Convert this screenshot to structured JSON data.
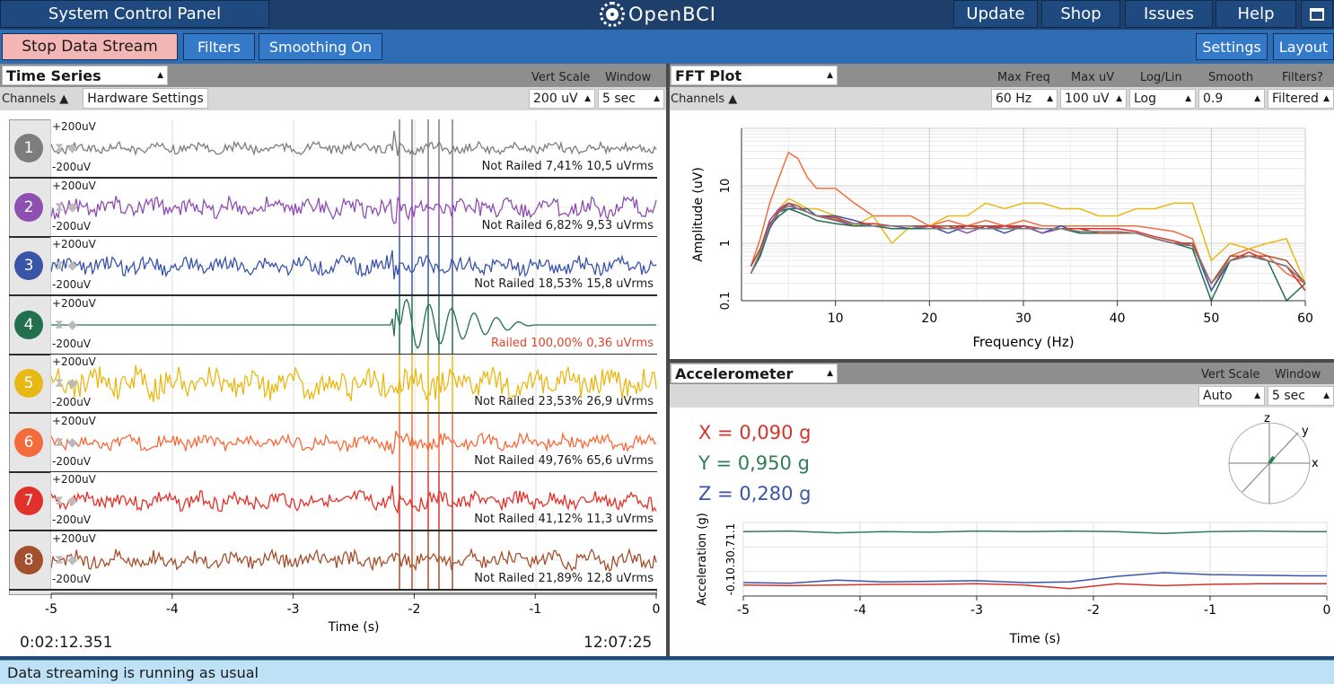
{
  "topbar": {
    "title": "System Control Panel",
    "logo": "OpenBCI",
    "update": "Update",
    "shop": "Shop",
    "issues": "Issues",
    "help": "Help"
  },
  "toolbar": {
    "stop": "Stop Data Stream",
    "filters": "Filters",
    "smoothing": "Smoothing On",
    "settings": "Settings",
    "layout": "Layout"
  },
  "timeseries": {
    "title": "Time Series",
    "vert_scale_label": "Vert Scale",
    "window_label": "Window",
    "channels_label": "Channels",
    "hardware": "Hardware Settings",
    "vert_scale": "200 uV",
    "window": "5 sec",
    "top_label": "+200uV",
    "bottom_label": "-200uV",
    "xlabel": "Time (s)",
    "xticks": [
      "-5",
      "-4",
      "-3",
      "-2",
      "-1",
      "0"
    ],
    "elapsed": "0:02:12.351",
    "clock": "12:07:25",
    "channels": [
      {
        "num": "1",
        "color": "#7d7d7d",
        "status": "Not Railed 7,41% 10,5 uVrms"
      },
      {
        "num": "2",
        "color": "#8d4fb0",
        "status": "Not Railed 6,82% 9,53 uVrms"
      },
      {
        "num": "3",
        "color": "#3a55a6",
        "status": "Not Railed 18,53% 15,8 uVrms"
      },
      {
        "num": "4",
        "color": "#23704e",
        "status": "Railed 100,00% 0,36 uVrms",
        "status_color": "#e0442c"
      },
      {
        "num": "5",
        "color": "#e8b915",
        "status": "Not Railed 23,53% 26,9 uVrms"
      },
      {
        "num": "6",
        "color": "#f26c3c",
        "status": "Not Railed 49,76% 65,6 uVrms"
      },
      {
        "num": "7",
        "color": "#e0322a",
        "status": "Not Railed 41,12% 11,3 uVrms"
      },
      {
        "num": "8",
        "color": "#a4502e",
        "status": "Not Railed 21,89% 12,8 uVrms"
      }
    ]
  },
  "fft": {
    "title": "FFT Plot",
    "channels_label": "Channels",
    "maxfreq_label": "Max Freq",
    "maxuv_label": "Max uV",
    "loglin_label": "Log/Lin",
    "smooth_label": "Smooth",
    "filters_label": "Filters?",
    "maxfreq": "60 Hz",
    "maxuv": "100 uV",
    "loglin": "Log",
    "smooth": "0.9",
    "filters": "Filtered",
    "xlabel": "Frequency (Hz)",
    "ylabel": "Amplitude (uV)",
    "xticks": [
      "10",
      "20",
      "30",
      "40",
      "50",
      "60"
    ],
    "yticks": [
      "0.1",
      "1",
      "10"
    ]
  },
  "accel": {
    "title": "Accelerometer",
    "vert_scale_label": "Vert Scale",
    "window_label": "Window",
    "vert_scale": "Auto",
    "window": "5 sec",
    "x": "X = 0,090 g",
    "y": "Y = 0,950 g",
    "z": "Z = 0,280 g",
    "x_color": "#d8332a",
    "y_color": "#2e7d55",
    "z_color": "#3a55a6",
    "axis_z": "z",
    "axis_y": "y",
    "axis_x": "x",
    "ylabel": "Acceleration (g)",
    "xlabel": "Time (s)",
    "yticks": "-0.10.30.71.1",
    "xticks": [
      "-5",
      "-4",
      "-3",
      "-2",
      "-1",
      "0"
    ]
  },
  "status": "Data streaming is running as usual",
  "chart_data": [
    {
      "type": "line",
      "title": "FFT Plot",
      "xlabel": "Frequency (Hz)",
      "ylabel": "Amplitude (uV)",
      "xlim": [
        0,
        60
      ],
      "ylim": [
        0.1,
        100
      ],
      "yscale": "log",
      "x": [
        1,
        2,
        3,
        4,
        5,
        6,
        7,
        8,
        10,
        12,
        14,
        16,
        18,
        20,
        22,
        24,
        26,
        28,
        30,
        32,
        34,
        36,
        38,
        40,
        42,
        44,
        46,
        48,
        50,
        52,
        54,
        56,
        58,
        60
      ],
      "series": [
        {
          "color": "#f26c3c",
          "values": [
            0.4,
            1.2,
            5,
            14,
            38,
            30,
            14,
            9,
            9,
            5,
            3,
            3,
            3,
            2,
            2.5,
            2,
            2.5,
            2,
            2.5,
            2,
            2,
            2,
            2,
            2,
            2,
            1.8,
            1.6,
            1.2,
            0.15,
            0.6,
            0.8,
            0.6,
            0.3,
            0.2
          ]
        },
        {
          "color": "#e8b915",
          "values": [
            0.3,
            0.7,
            2,
            4,
            6,
            5,
            4,
            4,
            3,
            2,
            3,
            1,
            2,
            2,
            3,
            3,
            5,
            4,
            5,
            5,
            4,
            4,
            3,
            3,
            4,
            4,
            5,
            5,
            0.5,
            1,
            0.8,
            1,
            1.2,
            0.2
          ]
        },
        {
          "color": "#3a55a6",
          "values": [
            0.3,
            0.6,
            1.8,
            3.5,
            4,
            4,
            4,
            3,
            3,
            2.5,
            2,
            2,
            2,
            2,
            1.5,
            2,
            2,
            1.5,
            2,
            1.5,
            2,
            1.5,
            1.5,
            1.5,
            1.5,
            1.2,
            1,
            1,
            0.15,
            0.5,
            0.6,
            0.5,
            0.4,
            0.2
          ]
        },
        {
          "color": "#8d4fb0",
          "values": [
            0.4,
            0.8,
            2.5,
            4,
            5,
            4,
            3.5,
            3,
            2.5,
            2,
            2,
            2,
            1.8,
            2,
            2,
            1.5,
            2,
            1.8,
            2,
            1.5,
            1.8,
            1.8,
            1.5,
            1.5,
            1.5,
            1.2,
            1,
            0.9,
            0.2,
            0.5,
            0.6,
            0.5,
            0.4,
            0.15
          ]
        },
        {
          "color": "#23704e",
          "values": [
            0.3,
            0.6,
            2,
            3,
            4,
            3.5,
            3,
            2.5,
            2.2,
            2,
            2,
            1.8,
            1.8,
            1.8,
            1.8,
            1.8,
            1.8,
            1.8,
            1.8,
            1.8,
            1.8,
            1.5,
            1.5,
            1.5,
            1.5,
            1.2,
            1,
            0.8,
            0.08,
            0.5,
            0.6,
            0.5,
            0.1,
            0.2
          ]
        },
        {
          "color": "#a4502e",
          "values": [
            0.4,
            0.8,
            2.2,
            3.5,
            5,
            4.5,
            3.5,
            3,
            2.5,
            2.2,
            2,
            2,
            2,
            2,
            2,
            2,
            1.8,
            2,
            1.8,
            1.8,
            1.8,
            1.8,
            1.5,
            1.5,
            1.5,
            1.2,
            1,
            1,
            0.2,
            0.6,
            0.6,
            0.6,
            0.5,
            0.2
          ]
        },
        {
          "color": "#e0322a",
          "values": [
            0.3,
            0.7,
            2,
            3.8,
            4.5,
            4,
            3.5,
            3,
            2.8,
            2.2,
            2.2,
            2,
            2,
            2,
            1.8,
            2,
            2,
            2,
            2,
            1.8,
            1.8,
            1.8,
            1.8,
            1.8,
            1.6,
            1.3,
            1.1,
            0.9,
            0.2,
            0.5,
            0.7,
            0.5,
            0.4,
            0.15
          ]
        },
        {
          "color": "#7d7d7d",
          "values": [
            0.3,
            0.7,
            2,
            3.5,
            4.5,
            4,
            3.5,
            3,
            2.6,
            2.2,
            2,
            2,
            2,
            1.8,
            1.8,
            1.8,
            1.8,
            1.8,
            1.8,
            1.8,
            1.8,
            1.6,
            1.6,
            1.6,
            1.5,
            1.2,
            1,
            0.9,
            0.2,
            0.5,
            0.6,
            0.5,
            0.4,
            0.2
          ]
        }
      ]
    },
    {
      "type": "line",
      "title": "Accelerometer",
      "xlabel": "Time (s)",
      "ylabel": "Acceleration (g)",
      "xlim": [
        -5,
        0
      ],
      "ylim": [
        -0.1,
        1.1
      ],
      "x": [
        -5,
        -4.6,
        -4.2,
        -3.8,
        -3.4,
        -3.0,
        -2.6,
        -2.2,
        -1.8,
        -1.4,
        -1.0,
        -0.6,
        -0.2,
        0
      ],
      "series": [
        {
          "name": "X",
          "color": "#d8332a",
          "values": [
            0.08,
            0.07,
            0.08,
            0.09,
            0.09,
            0.1,
            0.08,
            0.02,
            0.1,
            0.07,
            0.09,
            0.1,
            0.1,
            0.1
          ]
        },
        {
          "name": "Y",
          "color": "#2e7d55",
          "values": [
            0.95,
            0.96,
            0.93,
            0.95,
            0.94,
            0.96,
            0.95,
            0.96,
            0.95,
            0.92,
            0.95,
            0.96,
            0.95,
            0.95
          ]
        },
        {
          "name": "Z",
          "color": "#3a55a6",
          "values": [
            0.12,
            0.11,
            0.16,
            0.13,
            0.14,
            0.15,
            0.12,
            0.13,
            0.22,
            0.28,
            0.25,
            0.24,
            0.23,
            0.23
          ]
        }
      ]
    }
  ]
}
